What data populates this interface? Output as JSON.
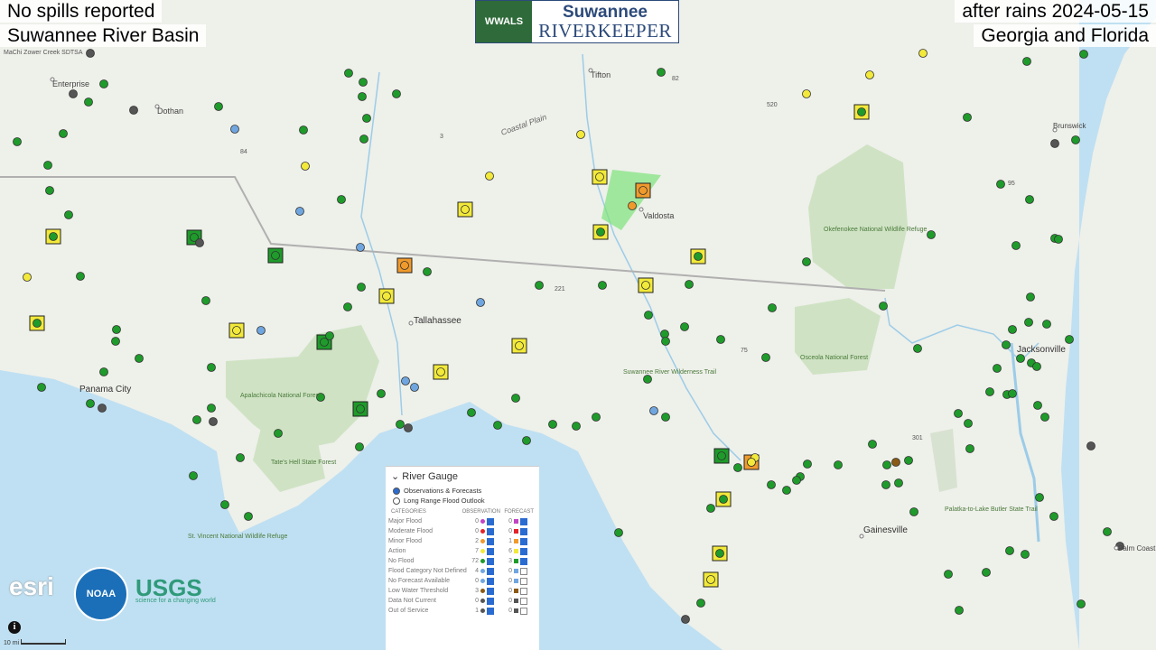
{
  "header": {
    "top_left": "No spills reported",
    "second_left": "Suwannee River Basin",
    "top_right": "after rains 2024-05-15",
    "second_right": "Georgia and Florida"
  },
  "logo": {
    "left_text": "WWALS",
    "line1": "Suwannee",
    "line2": "RIVERKEEPER"
  },
  "colors": {
    "no_flood": "#1e9b2a",
    "action": "#f2e93a",
    "minor_flood": "#f09a2c",
    "moderate_flood": "#e3222a",
    "major_flood": "#c243c6",
    "no_category": "#6fa6e0",
    "out_of_service": "#555555",
    "low_water": "#8a5a14",
    "land": "#eef0ea",
    "water": "#bfe0f2",
    "forest": "#cfe3c4"
  },
  "places": [
    {
      "name": "Tifton"
    },
    {
      "name": "Valdosta"
    },
    {
      "name": "Dothan"
    },
    {
      "name": "Enterprise"
    },
    {
      "name": "Tallahassee"
    },
    {
      "name": "Panama City"
    },
    {
      "name": "Jacksonville"
    },
    {
      "name": "Gainesville"
    },
    {
      "name": "Brunswick"
    },
    {
      "name": "Coastal Plain"
    },
    {
      "name": "Okefenokee National Wildlife Refuge"
    },
    {
      "name": "Osceola National Forest"
    },
    {
      "name": "Apalachicola National Forest"
    },
    {
      "name": "Tate's Hell State Forest"
    },
    {
      "name": "Suwannee River Wilderness Trail"
    },
    {
      "name": "St. Vincent National Wildlife Refuge"
    },
    {
      "name": "Palatka-to-Lake Butler State Trail"
    },
    {
      "name": "MaChi Zower Creek SDTSA"
    },
    {
      "name": "Palm Coast"
    }
  ],
  "roads": [
    "82",
    "520",
    "84",
    "3",
    "221",
    "75",
    "95",
    "301"
  ],
  "legend": {
    "title": "River Gauge",
    "options": [
      "Observations & Forecasts",
      "Long Range Flood Outlook"
    ],
    "col_categories": "CATEGORIES",
    "col_observation": "OBSERVATION",
    "col_forecast": "FORECAST",
    "rows": [
      {
        "label": "Major Flood",
        "obs": "0",
        "fc": "0"
      },
      {
        "label": "Moderate Flood",
        "obs": "0",
        "fc": "0"
      },
      {
        "label": "Minor Flood",
        "obs": "2",
        "fc": "1"
      },
      {
        "label": "Action",
        "obs": "7",
        "fc": "6"
      },
      {
        "label": "No Flood",
        "obs": "72",
        "fc": "3"
      },
      {
        "label": "Flood Category Not Defined",
        "obs": "4",
        "fc": "0"
      },
      {
        "label": "No Forecast Available",
        "obs": "0",
        "fc": "0"
      },
      {
        "label": "Low Water Threshold",
        "obs": "3",
        "fc": "0"
      },
      {
        "label": "Data Not Current",
        "obs": "0",
        "fc": "0"
      },
      {
        "label": "Out of Service",
        "obs": "1",
        "fc": "0"
      }
    ]
  },
  "attribution": {
    "esri": "POWERED BY esri",
    "noaa": "NOAA",
    "usgs": "USGS",
    "usgs_tag": "science for a changing world",
    "scale": "10 mi"
  }
}
